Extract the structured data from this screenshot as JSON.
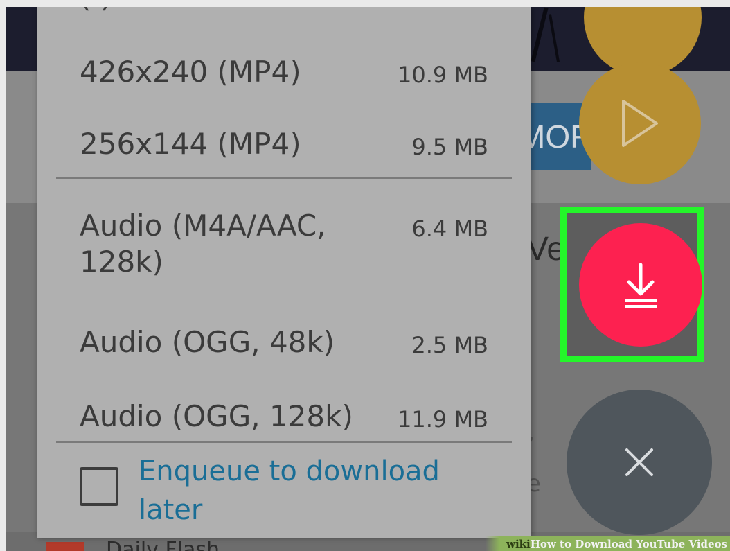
{
  "menu": {
    "items": [
      {
        "label": "426x240 (MP4)",
        "size": "10.9 MB"
      },
      {
        "label": "256x144 (MP4)",
        "size": "9.5 MB"
      },
      {
        "label": "Audio (M4A/AAC, 128k)",
        "size": "6.4 MB"
      },
      {
        "label": "Audio (OGG, 48k)",
        "size": "2.5 MB"
      },
      {
        "label": "Audio (OGG, 128k)",
        "size": "11.9 MB"
      }
    ],
    "enqueue_label": "Enqueue to download later",
    "enqueue_checked": false
  },
  "background": {
    "more_label": "MOR",
    "title_fragment": "Ve",
    "bottom_fragment": "Daily Flash"
  },
  "fabs": [
    "play-icon",
    "download-icon",
    "close-icon"
  ],
  "watermark": {
    "brand": "wiki",
    "text": "How to Download YouTube Videos"
  },
  "colors": {
    "download_fab": "#fd2150",
    "play_fab": "#b78f32",
    "close_fab": "#4f565c",
    "highlight": "#24f52a",
    "link": "#1a6e96"
  }
}
